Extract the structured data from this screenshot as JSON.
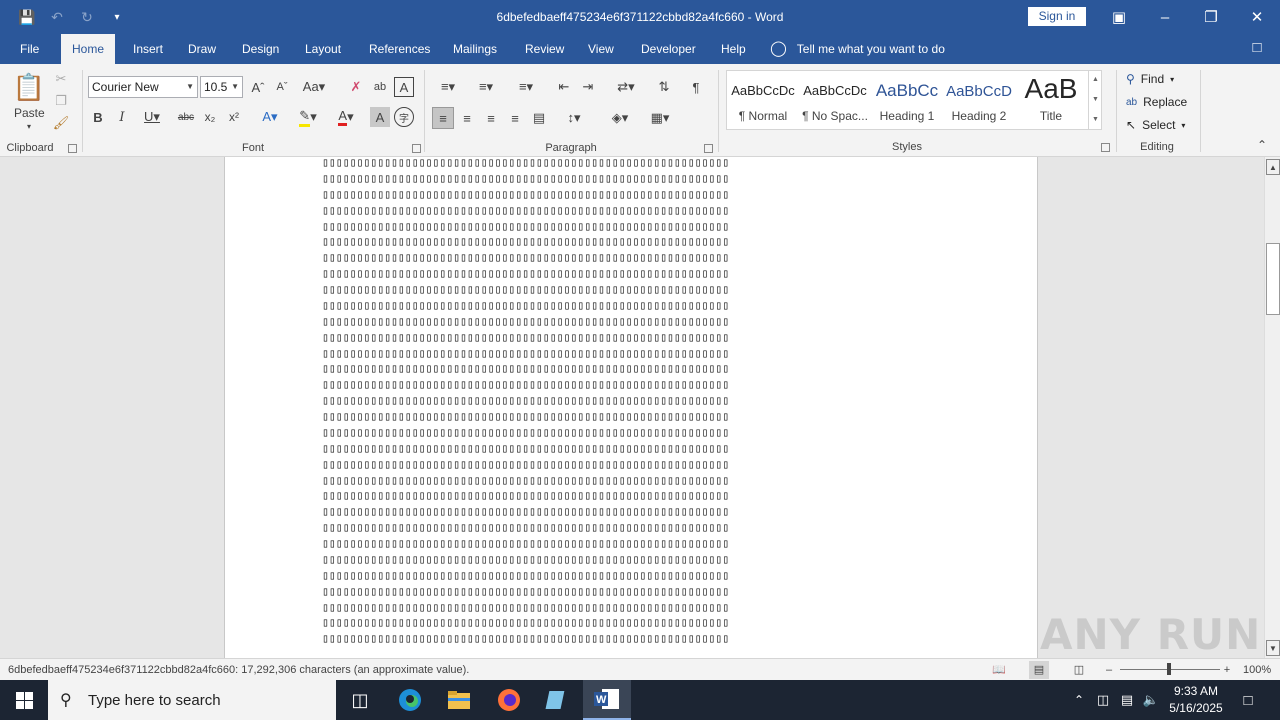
{
  "window": {
    "title": "6dbefedbaeff475234e6f371122cbbd82a4fc660  -  Word",
    "sign_in": "Sign in"
  },
  "tabs": [
    "File",
    "Home",
    "Insert",
    "Draw",
    "Design",
    "Layout",
    "References",
    "Mailings",
    "Review",
    "View",
    "Developer",
    "Help"
  ],
  "active_tab": "Home",
  "tell_me": "Tell me what you want to do",
  "ribbon": {
    "clipboard": {
      "label": "Clipboard",
      "paste": "Paste"
    },
    "font": {
      "label": "Font",
      "name": "Courier New",
      "size": "10.5"
    },
    "paragraph": {
      "label": "Paragraph"
    },
    "styles": {
      "label": "Styles",
      "items": [
        {
          "sample": "AaBbCcDc",
          "name": "¶ Normal"
        },
        {
          "sample": "AaBbCcDc",
          "name": "¶ No Spac..."
        },
        {
          "sample": "AaBbCc",
          "name": "Heading 1"
        },
        {
          "sample": "AaBbCcD",
          "name": "Heading 2"
        },
        {
          "sample": "AaB",
          "name": "Title"
        }
      ]
    },
    "editing": {
      "label": "Editing",
      "find": "Find",
      "replace": "Replace",
      "select": "Select"
    }
  },
  "document": {
    "glyph": "▯",
    "chars_per_line": 59,
    "lines": 31
  },
  "status": {
    "text": "6dbefedbaeff475234e6f371122cbbd82a4fc660: 17,292,306 characters (an approximate value).",
    "zoom": "100%",
    "zoom_value": 100
  },
  "taskbar": {
    "search_placeholder": "Type here to search",
    "time": "9:33 AM",
    "date": "5/16/2025"
  },
  "watermark": "ANY RUN",
  "colors": {
    "accent": "#2b579a",
    "taskbar": "#1c2533"
  }
}
